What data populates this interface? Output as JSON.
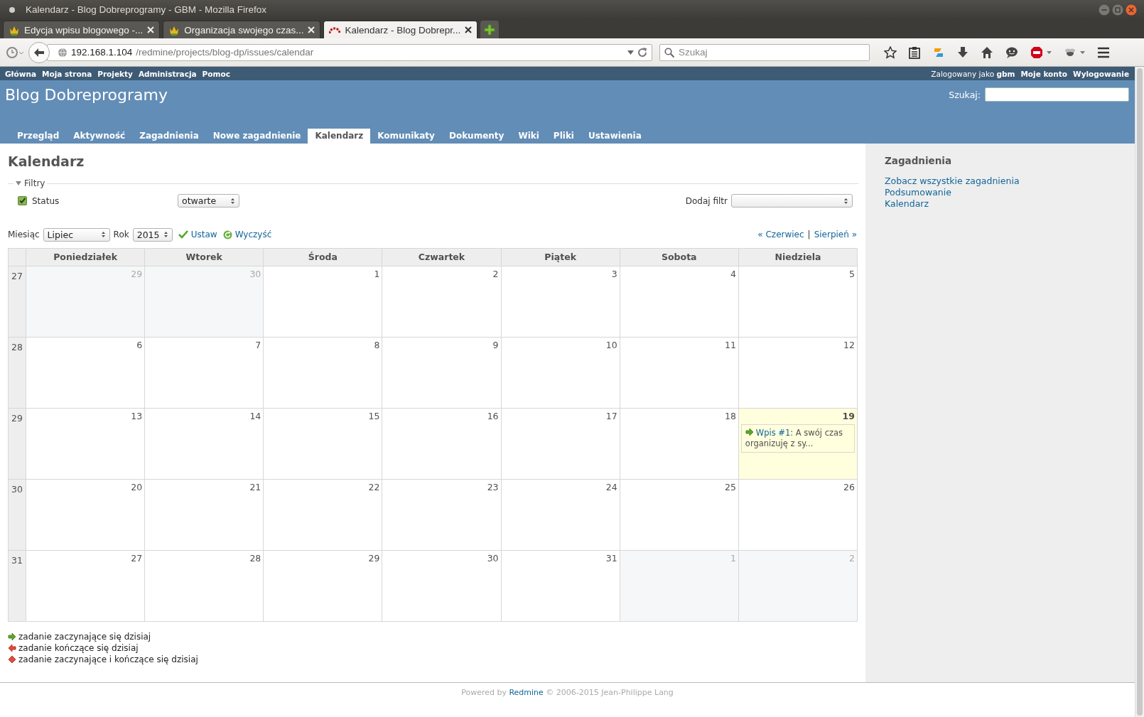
{
  "browser": {
    "window_title": "Kalendarz - Blog Dobreprogramy - GBM - Mozilla Firefox",
    "tabs": [
      {
        "label": "Edycja wpisu blogowego -...",
        "selected": false
      },
      {
        "label": "Organizacja swojego czas...",
        "selected": false
      },
      {
        "label": "Kalendarz - Blog Dobrepr...",
        "selected": true
      }
    ],
    "address": {
      "host": "192.168.1.104",
      "path": "/redmine/projects/blog-dp/issues/calendar"
    },
    "search": {
      "placeholder": "Szukaj"
    }
  },
  "top_menu": {
    "items": [
      "Główna",
      "Moja strona",
      "Projekty",
      "Administracja",
      "Pomoc"
    ],
    "logged_in": "Zalogowany jako **gbm**",
    "account": [
      "Moje konto",
      "Wylogowanie"
    ]
  },
  "header": {
    "title": "Blog Dobreprogramy",
    "search_label": "Szukaj:"
  },
  "main_menu": [
    {
      "label": "Przegląd",
      "selected": false
    },
    {
      "label": "Aktywność",
      "selected": false
    },
    {
      "label": "Zagadnienia",
      "selected": false
    },
    {
      "label": "Nowe zagadnienie",
      "selected": false
    },
    {
      "label": "Kalendarz",
      "selected": true
    },
    {
      "label": "Komunikaty",
      "selected": false
    },
    {
      "label": "Dokumenty",
      "selected": false
    },
    {
      "label": "Wiki",
      "selected": false
    },
    {
      "label": "Pliki",
      "selected": false
    },
    {
      "label": "Ustawienia",
      "selected": false
    }
  ],
  "page_title": "Kalendarz",
  "filters": {
    "legend": "Filtry",
    "expanded": true,
    "status": {
      "label": "Status",
      "checked": true,
      "value": "otwarte"
    },
    "add_filter_label": "Dodaj filtr"
  },
  "month_form": {
    "month_label": "Miesiąc",
    "month": "Lipiec",
    "year_label": "Rok",
    "year": "2015",
    "apply": "Ustaw",
    "clear": "Wyczyść"
  },
  "month_nav": {
    "previous": "« Czerwiec",
    "separator": "|",
    "next": "Sierpień »"
  },
  "calendar": {
    "columns": [
      "Poniedziałek",
      "Wtorek",
      "Środa",
      "Czwartek",
      "Piątek",
      "Sobota",
      "Niedziela"
    ],
    "weeks": [
      {
        "number": "27",
        "days": [
          {
            "day": "29",
            "other_month": true,
            "today": false
          },
          {
            "day": "30",
            "other_month": true,
            "today": false
          },
          {
            "day": "1",
            "other_month": false,
            "today": false
          },
          {
            "day": "2",
            "other_month": false,
            "today": false
          },
          {
            "day": "3",
            "other_month": false,
            "today": false
          },
          {
            "day": "4",
            "other_month": false,
            "today": false
          },
          {
            "day": "5",
            "other_month": false,
            "today": false
          }
        ]
      },
      {
        "number": "28",
        "days": [
          {
            "day": "6",
            "other_month": false,
            "today": false
          },
          {
            "day": "7",
            "other_month": false,
            "today": false
          },
          {
            "day": "8",
            "other_month": false,
            "today": false
          },
          {
            "day": "9",
            "other_month": false,
            "today": false
          },
          {
            "day": "10",
            "other_month": false,
            "today": false
          },
          {
            "day": "11",
            "other_month": false,
            "today": false
          },
          {
            "day": "12",
            "other_month": false,
            "today": false
          }
        ]
      },
      {
        "number": "29",
        "days": [
          {
            "day": "13",
            "other_month": false,
            "today": false
          },
          {
            "day": "14",
            "other_month": false,
            "today": false
          },
          {
            "day": "15",
            "other_month": false,
            "today": false
          },
          {
            "day": "16",
            "other_month": false,
            "today": false
          },
          {
            "day": "17",
            "other_month": false,
            "today": false
          },
          {
            "day": "18",
            "other_month": false,
            "today": false
          },
          {
            "day": "19",
            "other_month": false,
            "today": true,
            "issues": [
              {
                "kind": "start",
                "link": "Wpis #1",
                "subject": ": A swój czas organizuję z sy..."
              }
            ]
          }
        ]
      },
      {
        "number": "30",
        "days": [
          {
            "day": "20",
            "other_month": false,
            "today": false
          },
          {
            "day": "21",
            "other_month": false,
            "today": false
          },
          {
            "day": "22",
            "other_month": false,
            "today": false
          },
          {
            "day": "23",
            "other_month": false,
            "today": false
          },
          {
            "day": "24",
            "other_month": false,
            "today": false
          },
          {
            "day": "25",
            "other_month": false,
            "today": false
          },
          {
            "day": "26",
            "other_month": false,
            "today": false
          }
        ]
      },
      {
        "number": "31",
        "days": [
          {
            "day": "27",
            "other_month": false,
            "today": false
          },
          {
            "day": "28",
            "other_month": false,
            "today": false
          },
          {
            "day": "29",
            "other_month": false,
            "today": false
          },
          {
            "day": "30",
            "other_month": false,
            "today": false
          },
          {
            "day": "31",
            "other_month": false,
            "today": false
          },
          {
            "day": "1",
            "other_month": true,
            "today": false
          },
          {
            "day": "2",
            "other_month": true,
            "today": false
          }
        ]
      }
    ]
  },
  "legend": [
    {
      "kind": "start",
      "text": "zadanie zaczynające się dzisiaj"
    },
    {
      "kind": "end",
      "text": "zadanie kończące się dzisiaj"
    },
    {
      "kind": "both",
      "text": "zadanie zaczynające i kończące się dzisiaj"
    }
  ],
  "sidebar": {
    "heading": "Zagadnienia",
    "links": [
      "Zobacz wszystkie zagadnienia",
      "Podsumowanie",
      "Kalendarz"
    ]
  },
  "footer": {
    "before": "Powered by",
    "link": "Redmine",
    "after": "© 2006-2015 Jean-Philippe Lang"
  }
}
